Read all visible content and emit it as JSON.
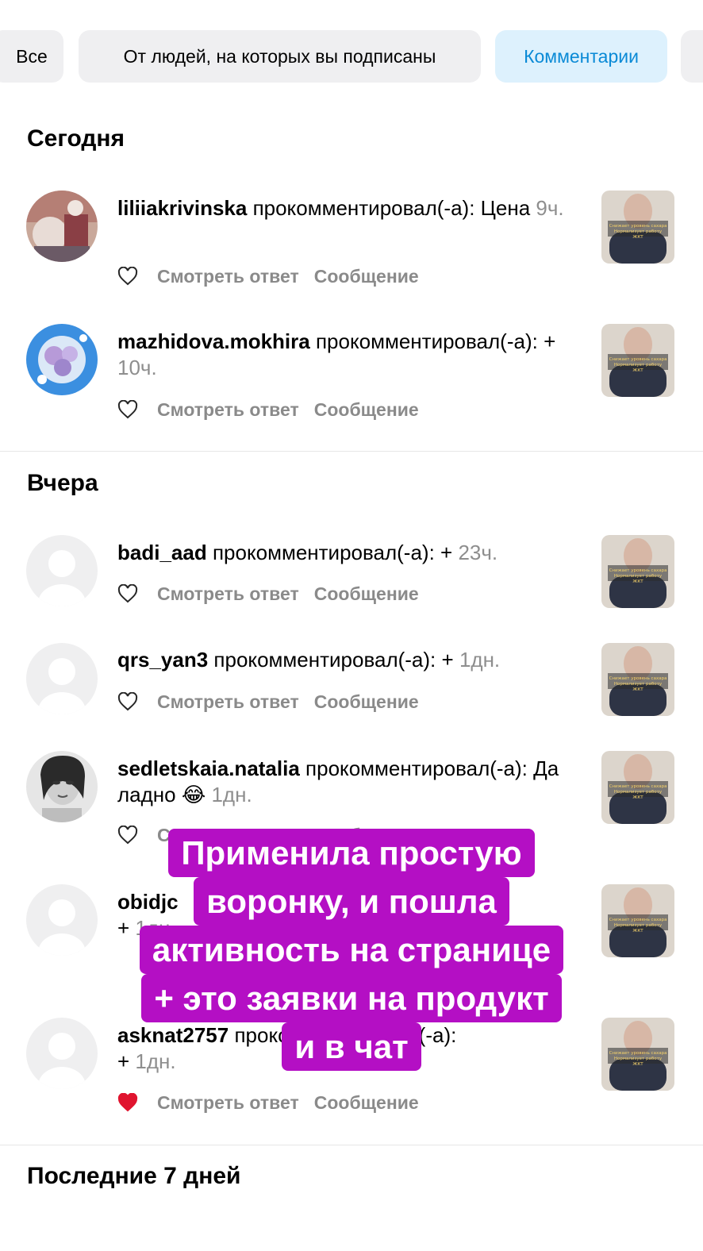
{
  "filters": [
    {
      "label": "Все",
      "active": false
    },
    {
      "label": "От людей, на которых вы подписаны",
      "active": false
    },
    {
      "label": "Комментарии",
      "active": true
    }
  ],
  "sections": {
    "today": "Сегодня",
    "yesterday": "Вчера",
    "last7": "Последние 7 дней"
  },
  "actions": {
    "view_reply": "Смотреть ответ",
    "message": "Сообщение"
  },
  "notifications": [
    {
      "user": "liliiakrivinska",
      "action": "прокомментировал(-а):",
      "comment": "Цена",
      "time": "9ч.",
      "liked": false
    },
    {
      "user": "mazhidova.mokhira",
      "action": "прокомментировал(-а):",
      "comment": "+",
      "time": "10ч.",
      "liked": false
    },
    {
      "user": "badi_aad",
      "action": "прокомментировал(-а):",
      "comment": "+",
      "time": "23ч.",
      "liked": false
    },
    {
      "user": "qrs_yan3",
      "action": "прокомментировал(-а):",
      "comment": "+",
      "time": "1дн.",
      "liked": false
    },
    {
      "user": "sedletskaia.natalia",
      "action": "прокомментировал(-а):",
      "comment": "Да ладно 😂",
      "time": "1дн.",
      "liked": false
    },
    {
      "user": "obidjc",
      "action": "",
      "comment": "+",
      "time": "1дн.",
      "liked": false
    },
    {
      "user": "asknat2757",
      "action": "прокомментировал(-а):",
      "comment": "+",
      "time": "1дн.",
      "liked": true
    }
  ],
  "thumbnail_caption": "Снижает уровень сахара Нормализует работу ЖКТ",
  "overlay_lines": [
    "Применила простую",
    "воронку, и пошла",
    "активность на странице",
    "+ это заявки на продукт",
    "и в чат"
  ],
  "colors": {
    "active_chip_bg": "#ddf1fd",
    "active_chip_text": "#0a8ad6",
    "overlay_bg": "#b40fc4",
    "heart_liked": "#e0142f"
  }
}
